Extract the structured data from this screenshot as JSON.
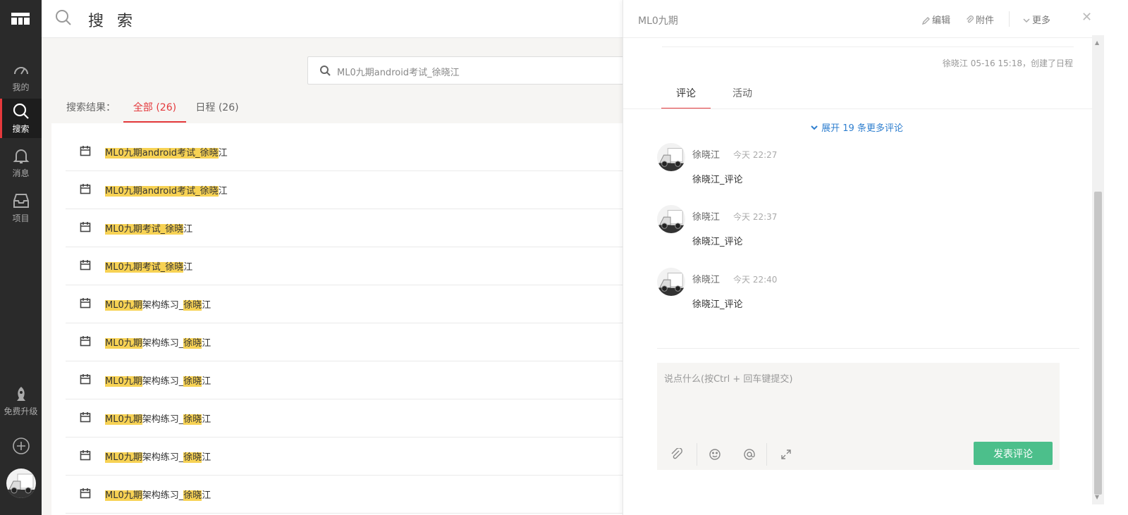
{
  "app": {
    "title": "搜 索"
  },
  "nav": {
    "items": [
      {
        "label": "我的",
        "icon": "dashboard-icon"
      },
      {
        "label": "搜索",
        "icon": "search-icon"
      },
      {
        "label": "消息",
        "icon": "bell-icon"
      },
      {
        "label": "项目",
        "icon": "inbox-icon"
      }
    ],
    "upgrade_label": "免费升级"
  },
  "search": {
    "value": "ML0九期android考试_徐晓江"
  },
  "filter": {
    "label": "搜索结果：",
    "tabs": [
      {
        "label": "全部 (26)",
        "active": true
      },
      {
        "label": "日程 (26)",
        "active": false
      }
    ]
  },
  "results": [
    {
      "hl1": "ML0九期android考试_",
      "hl2": "徐晓",
      "tail": "江"
    },
    {
      "hl1": "ML0九期android考试_",
      "hl2": "徐晓",
      "tail": "江"
    },
    {
      "hl1": "ML0九期考试_",
      "hl2": "徐晓",
      "tail": "江"
    },
    {
      "hl1": "ML0九期考试_",
      "hl2": "徐晓",
      "tail": "江"
    },
    {
      "hl1": "ML0九期",
      "mid": "架构练习_",
      "hl2": "徐晓",
      "tail": "江"
    },
    {
      "hl1": "ML0九期",
      "mid": "架构练习_",
      "hl2": "徐晓",
      "tail": "江"
    },
    {
      "hl1": "ML0九期",
      "mid": "架构练习_",
      "hl2": "徐晓",
      "tail": "江"
    },
    {
      "hl1": "ML0九期",
      "mid": "架构练习_",
      "hl2": "徐晓",
      "tail": "江"
    },
    {
      "hl1": "ML0九期",
      "mid": "架构练习_",
      "hl2": "徐晓",
      "tail": "江"
    },
    {
      "hl1": "ML0九期",
      "mid": "架构练习_",
      "hl2": "徐晓",
      "tail": "江"
    }
  ],
  "panel": {
    "title": "ML0九期",
    "actions": {
      "edit": "编辑",
      "attach": "附件",
      "more": "更多"
    },
    "created": "徐晓江 05-16 15:18，创建了日程",
    "tabs": [
      {
        "label": "评论",
        "active": true
      },
      {
        "label": "活动",
        "active": false
      }
    ],
    "expand": "展开 19 条更多评论",
    "comments": [
      {
        "name": "徐晓江",
        "time": "今天 22:27",
        "body": "徐晓江_评论"
      },
      {
        "name": "徐晓江",
        "time": "今天 22:37",
        "body": "徐晓江_评论"
      },
      {
        "name": "徐晓江",
        "time": "今天 22:40",
        "body": "徐晓江_评论"
      }
    ],
    "editor": {
      "placeholder": "说点什么(按Ctrl + 回车键提交)",
      "submit": "发表评论"
    }
  },
  "colors": {
    "accent": "#e4393c",
    "highlight": "#f7d254",
    "submit": "#4cbf8b",
    "link": "#2f7fcf"
  }
}
